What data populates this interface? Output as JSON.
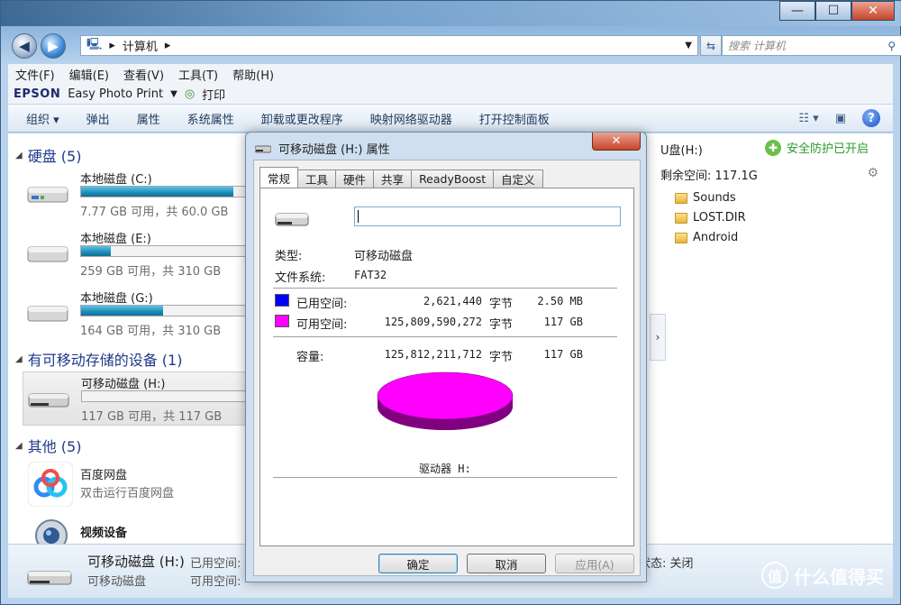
{
  "window": {
    "controls": {
      "minimize": "—",
      "maximize": "☐",
      "close": "✕"
    }
  },
  "address": {
    "path_root_icon": "computer-icon",
    "path": "计算机",
    "search_placeholder": "搜索 计算机"
  },
  "menu": [
    "文件(F)",
    "编辑(E)",
    "查看(V)",
    "工具(T)",
    "帮助(H)"
  ],
  "epson": {
    "brand": "EPSON",
    "app": "Easy Photo Print",
    "dropdown": "▼",
    "print": "打印"
  },
  "toolbar": {
    "items": [
      "组织 ▾",
      "弹出",
      "属性",
      "系统属性",
      "卸载或更改程序",
      "映射网络驱动器",
      "打开控制面板"
    ]
  },
  "groups": {
    "hdd": "硬盘 (5)",
    "removable": "有可移动存储的设备 (1)",
    "other": "其他 (5)"
  },
  "drives": [
    {
      "name": "本地磁盘 (C:)",
      "free": "7.77 GB 可用，共 60.0 GB",
      "fill": 0.87
    },
    {
      "name": "本地磁盘 (E:)",
      "free": "259 GB 可用，共 310 GB",
      "fill": 0.17
    },
    {
      "name": "本地磁盘 (G:)",
      "free": "164 GB 可用，共 310 GB",
      "fill": 0.47
    }
  ],
  "removable_drive": {
    "name": "可移动磁盘 (H:)",
    "free": "117 GB 可用，共 117 GB",
    "fill": 0.0
  },
  "others": [
    {
      "name": "百度网盘",
      "sub": "双击运行百度网盘"
    },
    {
      "name": "视频设备",
      "sub": ""
    }
  ],
  "right_pane": {
    "title": "U盘(H:)",
    "safe": "安全防护已开启",
    "remain": "剩余空间: 117.1G",
    "folders": [
      "Sounds",
      "LOST.DIR",
      "Android"
    ]
  },
  "details": {
    "title": "可移动磁盘 (H:)",
    "subtitle": "可移动磁盘",
    "used_label": "已用空间:",
    "avail_label": "可用空间:",
    "status": "状态: 关闭"
  },
  "watermark": {
    "glyph": "值",
    "text": "什么值得买"
  },
  "dialog": {
    "title": "可移动磁盘 (H:) 属性",
    "close": "✕",
    "tabs": [
      "常规",
      "工具",
      "硬件",
      "共享",
      "ReadyBoost",
      "自定义"
    ],
    "name_value": "",
    "type_label": "类型:",
    "type_value": "可移动磁盘",
    "fs_label": "文件系统:",
    "fs_value": "FAT32",
    "used_label": "已用空间:",
    "used_bytes": "2,621,440",
    "used_unit": "字节",
    "used_h": "2.50 MB",
    "free_label": "可用空间:",
    "free_bytes": "125,809,590,272",
    "free_unit": "字节",
    "free_h": "117 GB",
    "cap_label": "容量:",
    "cap_bytes": "125,812,211,712",
    "cap_unit": "字节",
    "cap_h": "117 GB",
    "drive_label": "驱动器 H:",
    "used_color": "#0000ff",
    "free_color": "#ff00ff",
    "ok": "确定",
    "cancel": "取消",
    "apply": "应用(A)"
  }
}
